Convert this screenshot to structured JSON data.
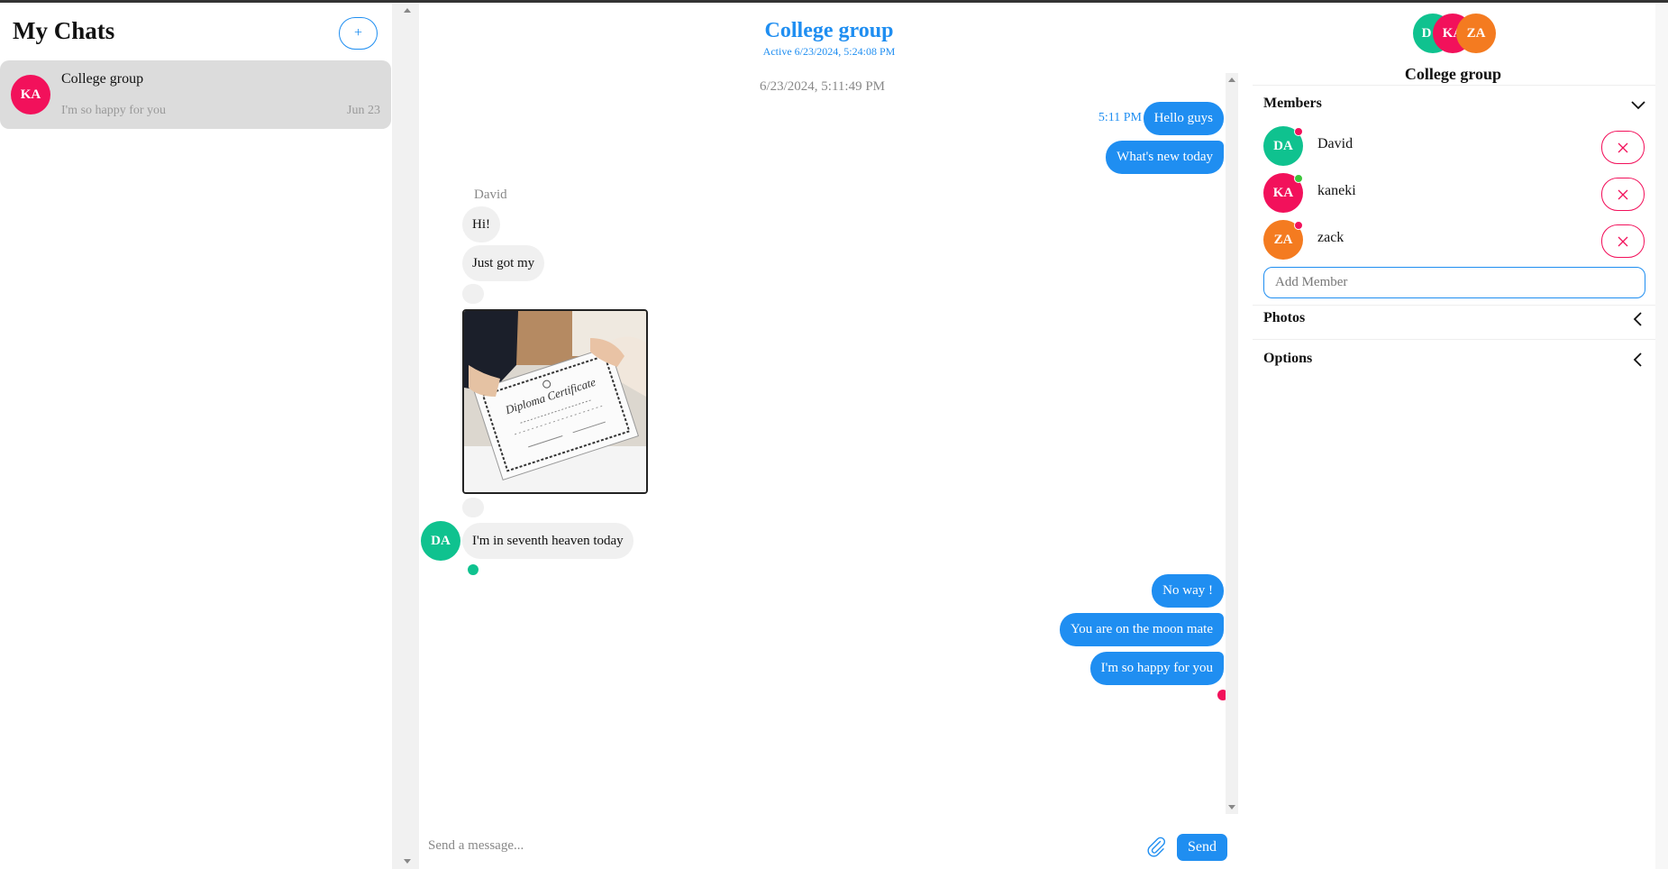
{
  "sidebar": {
    "title": "My Chats",
    "new_chat_label": "+",
    "chats": [
      {
        "avatar": "KA",
        "name": "College group",
        "last_message": "I'm so happy for you",
        "date": "Jun 23"
      }
    ]
  },
  "chat": {
    "title": "College group",
    "active": "Active 6/23/2024, 5:24:08 PM",
    "date_stamp": "6/23/2024, 5:11:49 PM",
    "messages": {
      "out1_time": "5:11 PM",
      "out1": "Hello guys",
      "out2": "What's new today",
      "sender": "David",
      "in1": "Hi!",
      "in2": "Just got my",
      "in3": "I'm in seventh heaven today",
      "in_avatar": "DA",
      "out3": "No way !",
      "out4": "You are on the moon mate",
      "out5": "I'm so happy for you"
    },
    "composer": {
      "placeholder": "Send a message...",
      "send_label": "Send"
    }
  },
  "details": {
    "group_avatars": [
      "D",
      "KA",
      "ZA"
    ],
    "title": "College group",
    "sections": {
      "members": "Members",
      "photos": "Photos",
      "options": "Options"
    },
    "members": [
      {
        "initials": "DA",
        "name": "David",
        "color": "#0fc28f",
        "status": "#f2115b"
      },
      {
        "initials": "KA",
        "name": "kaneki",
        "color": "#f2115b",
        "status": "#3cc63c"
      },
      {
        "initials": "ZA",
        "name": "zack",
        "color": "#f47b20",
        "status": "#f2115b"
      }
    ],
    "add_member_placeholder": "Add Member"
  },
  "colors": {
    "accent": "#1f8ef1",
    "danger": "#f2115b",
    "green": "#0fc28f",
    "orange": "#f47b20"
  }
}
